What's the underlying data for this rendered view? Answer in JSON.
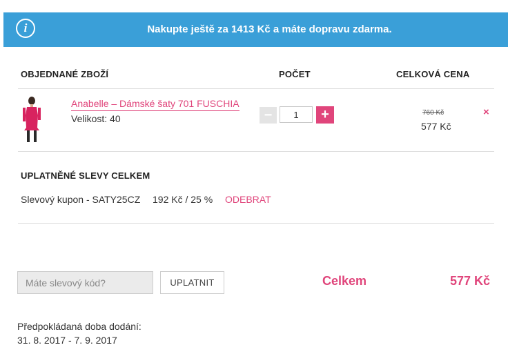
{
  "banner": {
    "icon": "info-icon",
    "text": "Nakupte ještě za 1413 Kč a máte dopravu zdarma.",
    "color": "#3a9fd8"
  },
  "table": {
    "col_product": "OBJEDNANÉ ZBOŽÍ",
    "col_quantity": "POČET",
    "col_total": "CELKOVÁ CENA"
  },
  "item": {
    "name": "Anabelle – Dámské šaty 701 FUSCHIA",
    "size": "Velikost: 40",
    "quantity": "1",
    "minus_label": "−",
    "plus_label": "+",
    "old_price": "760 Kč",
    "price": "577 Kč",
    "remove_icon": "×"
  },
  "discounts": {
    "title": "UPLATNĚNÉ SLEVY CELKEM",
    "coupon_label": "Slevový kupon - SATY25CZ",
    "coupon_value": "192 Kč / 25 %",
    "remove_label": "ODEBRAT"
  },
  "coupon_form": {
    "placeholder": "Máte slevový kód?",
    "apply_label": "UPLATNIT"
  },
  "summary": {
    "total_label": "Celkem",
    "total_value": "577 Kč"
  },
  "delivery": {
    "label": "Předpokládaná doba dodání:",
    "range": "31. 8. 2017 - 7. 9. 2017"
  },
  "colors": {
    "accent": "#e0457b",
    "banner": "#3a9fd8"
  }
}
